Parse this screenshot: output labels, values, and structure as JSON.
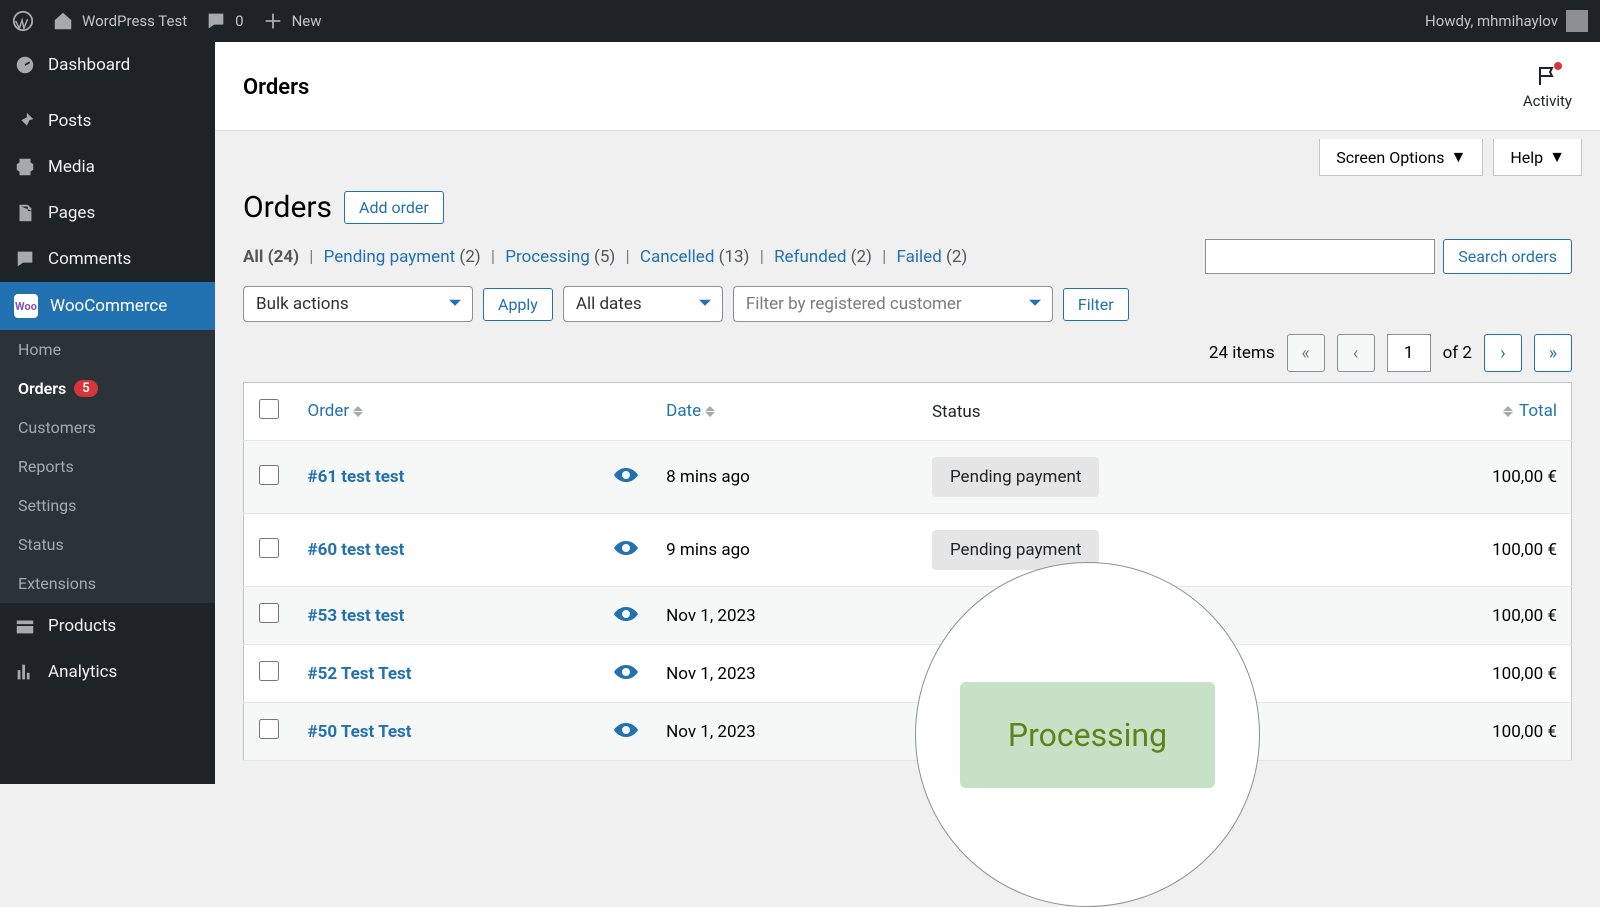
{
  "adminbar": {
    "site_name": "WordPress Test",
    "comments_count": "0",
    "new_label": "New",
    "greeting": "Howdy, mhmihaylov"
  },
  "sidebar": {
    "dashboard": "Dashboard",
    "posts": "Posts",
    "media": "Media",
    "pages": "Pages",
    "comments": "Comments",
    "woocommerce": "WooCommerce",
    "woo_badge": "Woo",
    "products": "Products",
    "analytics": "Analytics",
    "sub": {
      "home": "Home",
      "orders": "Orders",
      "orders_count": "5",
      "customers": "Customers",
      "reports": "Reports",
      "settings": "Settings",
      "status": "Status",
      "extensions": "Extensions"
    }
  },
  "titlebar": {
    "title": "Orders",
    "activity": "Activity"
  },
  "screen_meta": {
    "screen_options": "Screen Options",
    "help": "Help"
  },
  "heading": {
    "title": "Orders",
    "add_order": "Add order"
  },
  "status_filters": {
    "all_label": "All",
    "all_count": "(24)",
    "pending_label": "Pending payment",
    "pending_count": "(2)",
    "processing_label": "Processing",
    "processing_count": "(5)",
    "cancelled_label": "Cancelled",
    "cancelled_count": "(13)",
    "refunded_label": "Refunded",
    "refunded_count": "(2)",
    "failed_label": "Failed",
    "failed_count": "(2)"
  },
  "search": {
    "button": "Search orders"
  },
  "actions": {
    "bulk": "Bulk actions",
    "apply": "Apply",
    "dates": "All dates",
    "customer_placeholder": "Filter by registered customer",
    "filter": "Filter"
  },
  "pagination": {
    "items_label": "24 items",
    "current": "1",
    "of_label": "of 2"
  },
  "columns": {
    "order": "Order",
    "date": "Date",
    "status": "Status",
    "total": "Total"
  },
  "rows": [
    {
      "order": "#61 test test",
      "date": "8 mins ago",
      "status": "Pending payment",
      "total": "100,00 €"
    },
    {
      "order": "#60 test test",
      "date": "9 mins ago",
      "status": "Pending payment",
      "total": "100,00 €"
    },
    {
      "order": "#53 test test",
      "date": "Nov 1, 2023",
      "status": "",
      "total": "100,00 €"
    },
    {
      "order": "#52 Test Test",
      "date": "Nov 1, 2023",
      "status": "",
      "total": "100,00 €"
    },
    {
      "order": "#50 Test Test",
      "date": "Nov 1, 2023",
      "status": "",
      "total": "100,00 €"
    }
  ],
  "magnifier": {
    "label": "Processing"
  }
}
